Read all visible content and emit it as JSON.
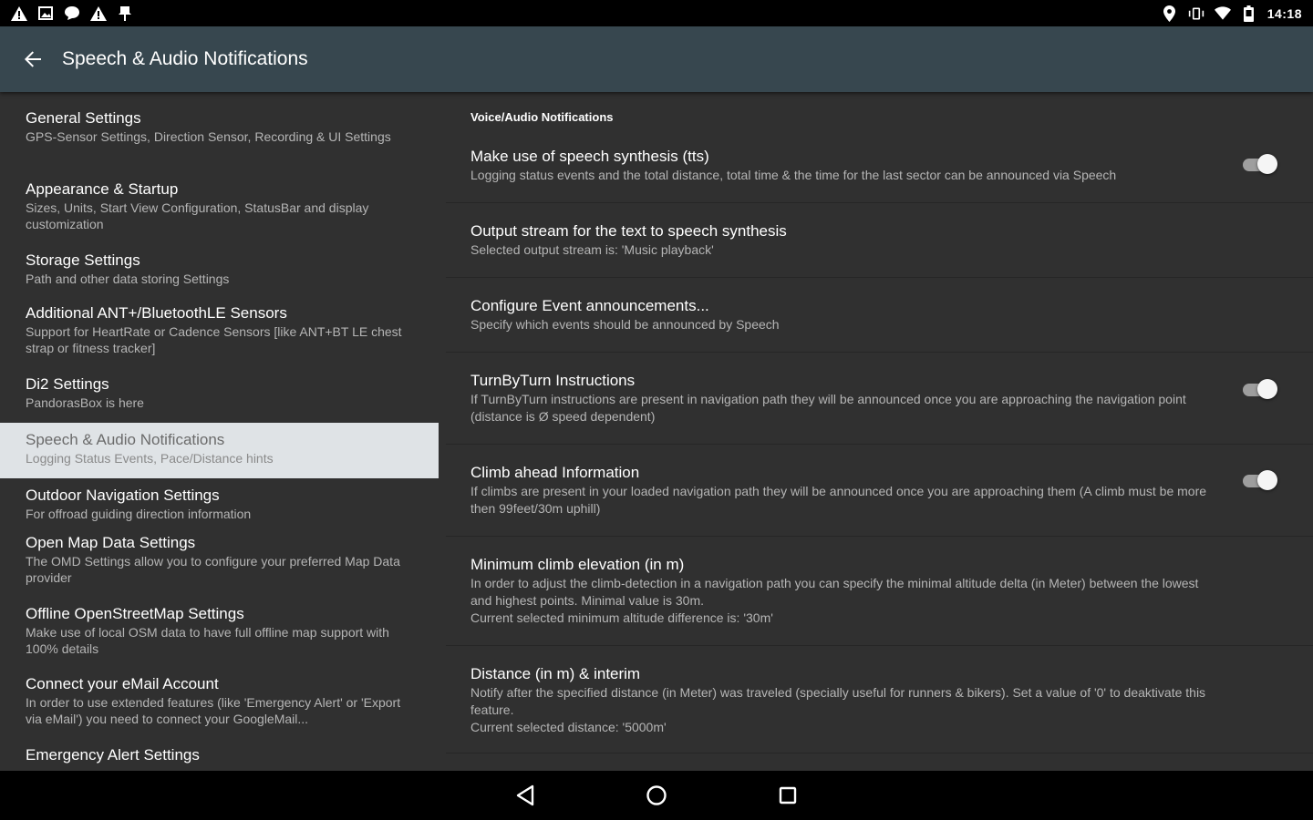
{
  "status_bar": {
    "left_icons": [
      "warning-icon",
      "image-icon",
      "chat-icon",
      "warning-icon",
      "pin-icon"
    ],
    "right_icons": [
      "location-icon",
      "vibrate-icon",
      "wifi-icon",
      "battery-icon"
    ],
    "time": "14:18"
  },
  "app_bar": {
    "title": "Speech & Audio Notifications",
    "background": "#37474f"
  },
  "sidebar": {
    "items": [
      {
        "title": "General Settings",
        "subtitle": "GPS-Sensor Settings, Direction Sensor, Recording & UI Settings"
      },
      {
        "title": "Appearance & Startup",
        "subtitle": "Sizes, Units, Start View Configuration, StatusBar and display customization"
      },
      {
        "title": "Storage Settings",
        "subtitle": "Path and other data storing Settings"
      },
      {
        "title": "Additional ANT+/BluetoothLE Sensors",
        "subtitle": "Support for HeartRate or Cadence Sensors [like ANT+BT LE chest strap or fitness tracker]"
      },
      {
        "title": "Di2 Settings",
        "subtitle": "PandorasBox is here"
      },
      {
        "title": "Speech & Audio Notifications",
        "subtitle": "Logging Status Events, Pace/Distance hints",
        "selected": true
      },
      {
        "title": "Outdoor Navigation Settings",
        "subtitle": "For offroad guiding direction information"
      },
      {
        "title": "Open Map Data Settings",
        "subtitle": "The OMD Settings allow you to configure your preferred Map Data provider"
      },
      {
        "title": "Offline OpenStreetMap Settings",
        "subtitle": "Make use of local OSM data to have full offline map support with 100% details"
      },
      {
        "title": "Connect your eMail Account",
        "subtitle": "In order to use extended features (like 'Emergency Alert' or 'Export via eMail') you need to connect your GoogleMail..."
      },
      {
        "title": "Emergency Alert Settings",
        "subtitle": ""
      }
    ]
  },
  "main": {
    "section_header": "Voice/Audio Notifications",
    "prefs": [
      {
        "title": "Make use of speech synthesis (tts)",
        "subtitle": "Logging status events and the total distance, total time & the time for the last sector can be announced via Speech",
        "switch": true,
        "switch_on": true
      },
      {
        "title": "Output stream for the text to speech synthesis",
        "subtitle": "Selected output stream is: 'Music playback'",
        "switch": false
      },
      {
        "title": "Configure Event announcements...",
        "subtitle": "Specify which events should be announced by Speech",
        "switch": false
      },
      {
        "title": "TurnByTurn Instructions",
        "subtitle": "If TurnByTurn instructions are present in navigation path they will be announced once you are approaching the navigation point (distance is Ø speed dependent)",
        "switch": true,
        "switch_on": true
      },
      {
        "title": "Climb ahead Information",
        "subtitle": "If climbs are present in your loaded navigation path they will be announced once you are approaching them (A climb must be more then 99feet/30m uphill)",
        "switch": true,
        "switch_on": true
      },
      {
        "title": "Minimum climb elevation (in m)",
        "subtitle": "In order to adjust the climb-detection in a navigation path you can specify the minimal altitude delta (in Meter) between the lowest and highest points. Minimal value is 30m.\nCurrent selected minimum altitude difference is: '30m'",
        "switch": false
      },
      {
        "title": "Distance (in m) & interim",
        "subtitle": "Notify after the specified distance (in Meter) was traveled (specially useful for runners & bikers). Set a value of '0' to deaktivate this feature.\nCurrent selected distance: '5000m'",
        "switch": false
      }
    ]
  },
  "nav_bar": {
    "buttons": [
      "back-triangle-icon",
      "home-circle-icon",
      "recents-square-icon"
    ]
  }
}
